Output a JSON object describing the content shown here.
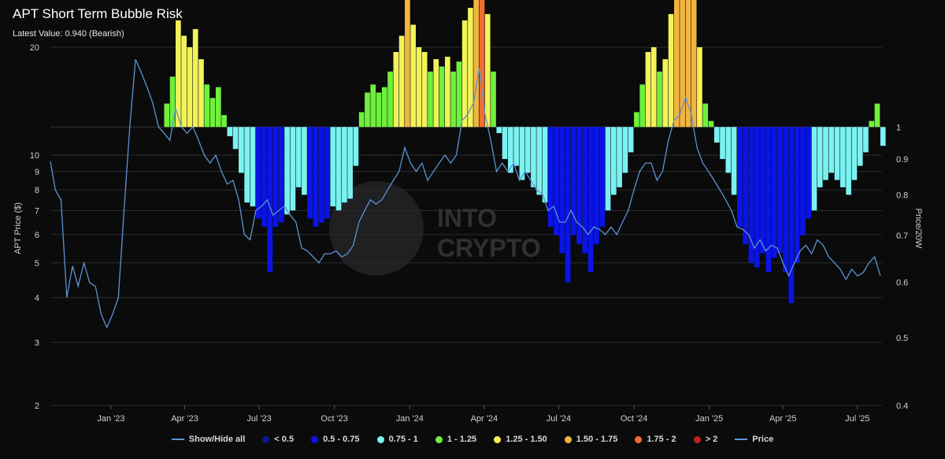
{
  "header": {
    "title": "APT Short Term Bubble Risk",
    "subtitle": "Latest Value: 0.940 (Bearish)"
  },
  "watermark": {
    "line1": "INTO",
    "line2": "CRYPTO"
  },
  "colors": {
    "lt0_5": "#0b1a8c",
    "0_5_0_75": "#0a14e6",
    "0_75_1": "#7af2f2",
    "1_1_25": "#6ff03c",
    "1_25_1_5": "#f2f25a",
    "1_5_1_75": "#f2b440",
    "1_75_2": "#ee6e2c",
    "gt2": "#b82222",
    "price": "#5b93d3"
  },
  "chart_data": {
    "type": "bar",
    "title": "APT Short Term Bubble Risk",
    "subtitle": "Latest Value: 0.940 (Bearish)",
    "y_left_label": "APT Price ($)",
    "y_right_label": "Price/20W",
    "y_left_ticks": [
      "20",
      "10",
      "9",
      "8",
      "7",
      "6",
      "5",
      "4",
      "3",
      "2"
    ],
    "y_right_ticks": [
      "1",
      "0.9",
      "0.8",
      "0.7",
      "0.6",
      "0.5",
      "0.4"
    ],
    "x_ticks": [
      "Jan '23",
      "Apr '23",
      "Jul '23",
      "Oct '23",
      "Jan '24",
      "Apr '24",
      "Jul '24",
      "Oct '24",
      "Jan '25",
      "Apr '25",
      "Jul '25"
    ],
    "y_left_scale": "log",
    "y_right_scale": "log",
    "y_left_range": [
      2,
      20
    ],
    "y_right_range": [
      0.4,
      1.3
    ],
    "x_range": [
      "2022-10-19",
      "2025-07-31"
    ],
    "baseline": 1,
    "latest_value": 0.94,
    "grid": true,
    "legend_position": "bottom",
    "legend": [
      {
        "label": "Show/Hide all",
        "kind": "line",
        "color": "#5b93d3"
      },
      {
        "label": "< 0.5",
        "kind": "dot",
        "color": "#0b1a8c"
      },
      {
        "label": "0.5 - 0.75",
        "kind": "dot",
        "color": "#0a14e6"
      },
      {
        "label": "0.75 - 1",
        "kind": "dot",
        "color": "#7af2f2"
      },
      {
        "label": "1 - 1.25",
        "kind": "dot",
        "color": "#6ff03c"
      },
      {
        "label": "1.25 - 1.50",
        "kind": "dot",
        "color": "#f2f25a"
      },
      {
        "label": "1.50 - 1.75",
        "kind": "dot",
        "color": "#f2b440"
      },
      {
        "label": "1.75 - 2",
        "kind": "dot",
        "color": "#ee6e2c"
      },
      {
        "label": "> 2",
        "kind": "dot",
        "color": "#b82222"
      },
      {
        "label": "Price",
        "kind": "line",
        "color": "#5b93d3"
      }
    ],
    "price_series": {
      "name": "Price",
      "points": [
        [
          "2022-10-19",
          9.6
        ],
        [
          "2022-10-25",
          8.0
        ],
        [
          "2022-11-01",
          7.5
        ],
        [
          "2022-11-08",
          4.0
        ],
        [
          "2022-11-15",
          4.9
        ],
        [
          "2022-11-22",
          4.3
        ],
        [
          "2022-11-29",
          5.0
        ],
        [
          "2022-12-06",
          4.4
        ],
        [
          "2022-12-13",
          4.3
        ],
        [
          "2022-12-20",
          3.6
        ],
        [
          "2022-12-27",
          3.3
        ],
        [
          "2023-01-03",
          3.6
        ],
        [
          "2023-01-10",
          4.0
        ],
        [
          "2023-01-17",
          7.0
        ],
        [
          "2023-01-24",
          12.0
        ],
        [
          "2023-01-31",
          18.5
        ],
        [
          "2023-02-07",
          17.0
        ],
        [
          "2023-02-14",
          15.5
        ],
        [
          "2023-02-21",
          14.0
        ],
        [
          "2023-02-28",
          12.0
        ],
        [
          "2023-03-07",
          11.5
        ],
        [
          "2023-03-14",
          11.0
        ],
        [
          "2023-03-21",
          13.5
        ],
        [
          "2023-03-28",
          12.0
        ],
        [
          "2023-04-04",
          11.5
        ],
        [
          "2023-04-11",
          12.0
        ],
        [
          "2023-04-18",
          11.0
        ],
        [
          "2023-04-25",
          10.0
        ],
        [
          "2023-05-02",
          9.5
        ],
        [
          "2023-05-09",
          10.0
        ],
        [
          "2023-05-16",
          9.0
        ],
        [
          "2023-05-23",
          8.3
        ],
        [
          "2023-05-30",
          8.5
        ],
        [
          "2023-06-06",
          7.5
        ],
        [
          "2023-06-13",
          6.0
        ],
        [
          "2023-06-20",
          5.8
        ],
        [
          "2023-06-27",
          7.0
        ],
        [
          "2023-07-04",
          7.2
        ],
        [
          "2023-07-11",
          7.5
        ],
        [
          "2023-07-18",
          6.8
        ],
        [
          "2023-07-25",
          7.0
        ],
        [
          "2023-08-01",
          7.2
        ],
        [
          "2023-08-08",
          6.8
        ],
        [
          "2023-08-15",
          6.5
        ],
        [
          "2023-08-22",
          5.5
        ],
        [
          "2023-08-29",
          5.4
        ],
        [
          "2023-09-05",
          5.2
        ],
        [
          "2023-09-12",
          5.0
        ],
        [
          "2023-09-19",
          5.3
        ],
        [
          "2023-09-26",
          5.3
        ],
        [
          "2023-10-03",
          5.4
        ],
        [
          "2023-10-10",
          5.2
        ],
        [
          "2023-10-17",
          5.3
        ],
        [
          "2023-10-24",
          5.6
        ],
        [
          "2023-10-31",
          6.5
        ],
        [
          "2023-11-07",
          7.0
        ],
        [
          "2023-11-14",
          7.5
        ],
        [
          "2023-11-21",
          7.3
        ],
        [
          "2023-11-28",
          7.5
        ],
        [
          "2023-12-05",
          8.0
        ],
        [
          "2023-12-12",
          8.5
        ],
        [
          "2023-12-19",
          9.0
        ],
        [
          "2023-12-26",
          10.5
        ],
        [
          "2024-01-02",
          9.5
        ],
        [
          "2024-01-09",
          9.0
        ],
        [
          "2024-01-16",
          9.5
        ],
        [
          "2024-01-23",
          8.5
        ],
        [
          "2024-01-30",
          9.0
        ],
        [
          "2024-02-06",
          9.5
        ],
        [
          "2024-02-13",
          10.0
        ],
        [
          "2024-02-20",
          9.5
        ],
        [
          "2024-02-27",
          10.0
        ],
        [
          "2024-03-05",
          12.5
        ],
        [
          "2024-03-12",
          13.0
        ],
        [
          "2024-03-19",
          14.0
        ],
        [
          "2024-03-26",
          17.5
        ],
        [
          "2024-04-02",
          13.0
        ],
        [
          "2024-04-09",
          11.0
        ],
        [
          "2024-04-16",
          9.0
        ],
        [
          "2024-04-23",
          9.5
        ],
        [
          "2024-04-30",
          9.0
        ],
        [
          "2024-05-07",
          9.5
        ],
        [
          "2024-05-14",
          8.5
        ],
        [
          "2024-05-21",
          9.0
        ],
        [
          "2024-05-28",
          8.5
        ],
        [
          "2024-06-04",
          8.0
        ],
        [
          "2024-06-11",
          7.8
        ],
        [
          "2024-06-18",
          7.0
        ],
        [
          "2024-06-25",
          7.2
        ],
        [
          "2024-07-02",
          6.5
        ],
        [
          "2024-07-09",
          6.5
        ],
        [
          "2024-07-16",
          7.0
        ],
        [
          "2024-07-23",
          6.5
        ],
        [
          "2024-07-30",
          6.3
        ],
        [
          "2024-08-06",
          6.0
        ],
        [
          "2024-08-13",
          6.3
        ],
        [
          "2024-08-20",
          6.2
        ],
        [
          "2024-08-27",
          6.0
        ],
        [
          "2024-09-03",
          6.3
        ],
        [
          "2024-09-10",
          6.0
        ],
        [
          "2024-09-17",
          6.5
        ],
        [
          "2024-09-24",
          7.0
        ],
        [
          "2024-10-01",
          8.0
        ],
        [
          "2024-10-08",
          9.0
        ],
        [
          "2024-10-15",
          9.5
        ],
        [
          "2024-10-22",
          9.5
        ],
        [
          "2024-10-29",
          8.5
        ],
        [
          "2024-11-05",
          9.0
        ],
        [
          "2024-11-12",
          11.0
        ],
        [
          "2024-11-19",
          12.5
        ],
        [
          "2024-11-26",
          13.0
        ],
        [
          "2024-12-03",
          14.5
        ],
        [
          "2024-12-10",
          13.0
        ],
        [
          "2024-12-17",
          10.5
        ],
        [
          "2024-12-24",
          9.5
        ],
        [
          "2024-12-31",
          9.0
        ],
        [
          "2025-01-07",
          8.5
        ],
        [
          "2025-01-14",
          8.0
        ],
        [
          "2025-01-21",
          7.5
        ],
        [
          "2025-01-28",
          7.0
        ],
        [
          "2025-02-04",
          6.3
        ],
        [
          "2025-02-11",
          6.2
        ],
        [
          "2025-02-18",
          6.0
        ],
        [
          "2025-02-25",
          5.5
        ],
        [
          "2025-03-04",
          5.8
        ],
        [
          "2025-03-11",
          5.4
        ],
        [
          "2025-03-18",
          5.6
        ],
        [
          "2025-03-25",
          5.5
        ],
        [
          "2025-04-01",
          5.0
        ],
        [
          "2025-04-08",
          4.6
        ],
        [
          "2025-04-15",
          5.0
        ],
        [
          "2025-04-22",
          5.4
        ],
        [
          "2025-04-29",
          5.6
        ],
        [
          "2025-05-06",
          5.3
        ],
        [
          "2025-05-13",
          5.8
        ],
        [
          "2025-05-20",
          5.6
        ],
        [
          "2025-05-27",
          5.2
        ],
        [
          "2025-06-03",
          5.0
        ],
        [
          "2025-06-10",
          4.8
        ],
        [
          "2025-06-17",
          4.5
        ],
        [
          "2025-06-24",
          4.8
        ],
        [
          "2025-07-01",
          4.6
        ],
        [
          "2025-07-08",
          4.7
        ],
        [
          "2025-07-15",
          5.0
        ],
        [
          "2025-07-22",
          5.2
        ],
        [
          "2025-07-29",
          4.6
        ]
      ]
    },
    "risk_series": {
      "name": "Price/20W",
      "points": [
        [
          "2023-03-07",
          1.08
        ],
        [
          "2023-03-14",
          1.18
        ],
        [
          "2023-03-21",
          1.42
        ],
        [
          "2023-03-28",
          1.35
        ],
        [
          "2023-04-04",
          1.3
        ],
        [
          "2023-04-11",
          1.38
        ],
        [
          "2023-04-18",
          1.25
        ],
        [
          "2023-04-25",
          1.15
        ],
        [
          "2023-05-02",
          1.1
        ],
        [
          "2023-05-09",
          1.14
        ],
        [
          "2023-05-16",
          1.04
        ],
        [
          "2023-05-23",
          0.97
        ],
        [
          "2023-05-30",
          0.93
        ],
        [
          "2023-06-06",
          0.86
        ],
        [
          "2023-06-13",
          0.78
        ],
        [
          "2023-06-20",
          0.77
        ],
        [
          "2023-06-27",
          0.74
        ],
        [
          "2023-07-04",
          0.72
        ],
        [
          "2023-07-11",
          0.62
        ],
        [
          "2023-07-18",
          0.72
        ],
        [
          "2023-07-25",
          0.73
        ],
        [
          "2023-08-01",
          0.75
        ],
        [
          "2023-08-08",
          0.76
        ],
        [
          "2023-08-15",
          0.82
        ],
        [
          "2023-08-22",
          0.8
        ],
        [
          "2023-08-29",
          0.74
        ],
        [
          "2023-09-05",
          0.72
        ],
        [
          "2023-09-12",
          0.73
        ],
        [
          "2023-09-19",
          0.74
        ],
        [
          "2023-09-26",
          0.77
        ],
        [
          "2023-10-03",
          0.76
        ],
        [
          "2023-10-10",
          0.78
        ],
        [
          "2023-10-17",
          0.79
        ],
        [
          "2023-10-24",
          0.88
        ],
        [
          "2023-10-31",
          1.05
        ],
        [
          "2023-11-07",
          1.12
        ],
        [
          "2023-11-14",
          1.15
        ],
        [
          "2023-11-21",
          1.12
        ],
        [
          "2023-11-28",
          1.14
        ],
        [
          "2023-12-05",
          1.2
        ],
        [
          "2023-12-12",
          1.28
        ],
        [
          "2023-12-19",
          1.35
        ],
        [
          "2023-12-26",
          1.52
        ],
        [
          "2024-01-02",
          1.4
        ],
        [
          "2024-01-09",
          1.3
        ],
        [
          "2024-01-16",
          1.28
        ],
        [
          "2024-01-23",
          1.2
        ],
        [
          "2024-01-30",
          1.25
        ],
        [
          "2024-02-06",
          1.22
        ],
        [
          "2024-02-13",
          1.26
        ],
        [
          "2024-02-20",
          1.2
        ],
        [
          "2024-02-27",
          1.24
        ],
        [
          "2024-03-05",
          1.42
        ],
        [
          "2024-03-12",
          1.48
        ],
        [
          "2024-03-19",
          1.55
        ],
        [
          "2024-03-26",
          1.78
        ],
        [
          "2024-04-02",
          1.45
        ],
        [
          "2024-04-09",
          1.2
        ],
        [
          "2024-04-16",
          0.98
        ],
        [
          "2024-04-23",
          0.9
        ],
        [
          "2024-04-30",
          0.86
        ],
        [
          "2024-05-07",
          0.88
        ],
        [
          "2024-05-14",
          0.84
        ],
        [
          "2024-05-21",
          0.86
        ],
        [
          "2024-05-28",
          0.82
        ],
        [
          "2024-06-04",
          0.8
        ],
        [
          "2024-06-11",
          0.78
        ],
        [
          "2024-06-18",
          0.72
        ],
        [
          "2024-06-25",
          0.7
        ],
        [
          "2024-07-02",
          0.66
        ],
        [
          "2024-07-09",
          0.6
        ],
        [
          "2024-07-16",
          0.7
        ],
        [
          "2024-07-23",
          0.68
        ],
        [
          "2024-07-30",
          0.66
        ],
        [
          "2024-08-06",
          0.62
        ],
        [
          "2024-08-13",
          0.68
        ],
        [
          "2024-08-20",
          0.72
        ],
        [
          "2024-08-27",
          0.76
        ],
        [
          "2024-09-03",
          0.8
        ],
        [
          "2024-09-10",
          0.82
        ],
        [
          "2024-09-17",
          0.86
        ],
        [
          "2024-09-24",
          0.92
        ],
        [
          "2024-10-01",
          1.05
        ],
        [
          "2024-10-08",
          1.15
        ],
        [
          "2024-10-15",
          1.28
        ],
        [
          "2024-10-22",
          1.3
        ],
        [
          "2024-10-29",
          1.2
        ],
        [
          "2024-11-05",
          1.25
        ],
        [
          "2024-11-12",
          1.45
        ],
        [
          "2024-11-19",
          1.58
        ],
        [
          "2024-11-26",
          1.62
        ],
        [
          "2024-12-03",
          1.7
        ],
        [
          "2024-12-10",
          1.6
        ],
        [
          "2024-12-17",
          1.3
        ],
        [
          "2024-12-24",
          1.08
        ],
        [
          "2024-12-31",
          1.02
        ],
        [
          "2025-01-07",
          0.95
        ],
        [
          "2025-01-14",
          0.9
        ],
        [
          "2025-01-21",
          0.86
        ],
        [
          "2025-01-28",
          0.8
        ],
        [
          "2025-02-04",
          0.72
        ],
        [
          "2025-02-11",
          0.68
        ],
        [
          "2025-02-18",
          0.64
        ],
        [
          "2025-02-25",
          0.63
        ],
        [
          "2025-03-04",
          0.66
        ],
        [
          "2025-03-11",
          0.62
        ],
        [
          "2025-03-18",
          0.65
        ],
        [
          "2025-03-25",
          0.66
        ],
        [
          "2025-04-01",
          0.62
        ],
        [
          "2025-04-08",
          0.56
        ],
        [
          "2025-04-15",
          0.64
        ],
        [
          "2025-04-22",
          0.7
        ],
        [
          "2025-04-29",
          0.74
        ],
        [
          "2025-05-06",
          0.76
        ],
        [
          "2025-05-13",
          0.82
        ],
        [
          "2025-05-20",
          0.84
        ],
        [
          "2025-05-27",
          0.86
        ],
        [
          "2025-06-03",
          0.84
        ],
        [
          "2025-06-10",
          0.82
        ],
        [
          "2025-06-17",
          0.8
        ],
        [
          "2025-06-24",
          0.84
        ],
        [
          "2025-07-01",
          0.88
        ],
        [
          "2025-07-08",
          0.92
        ],
        [
          "2025-07-15",
          1.02
        ],
        [
          "2025-07-22",
          1.08
        ],
        [
          "2025-07-29",
          0.94
        ]
      ]
    }
  }
}
